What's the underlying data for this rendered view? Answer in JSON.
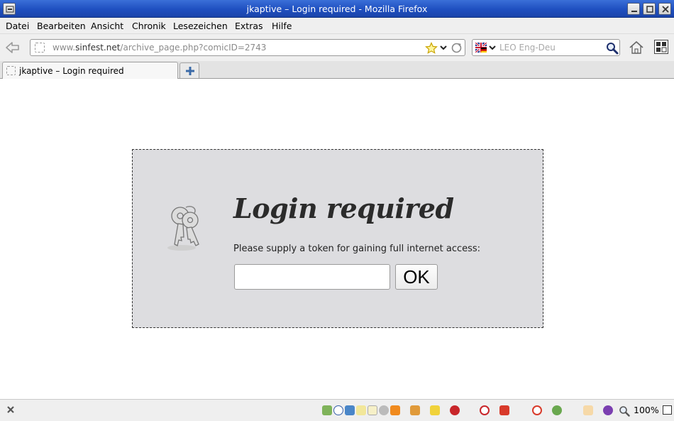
{
  "window": {
    "title": "jkaptive – Login required - Mozilla Firefox"
  },
  "menu": {
    "items": [
      {
        "label": "Datei"
      },
      {
        "label": "Bearbeiten"
      },
      {
        "label": "Ansicht"
      },
      {
        "label": "Chronik"
      },
      {
        "label": "Lesezeichen"
      },
      {
        "label": "Extras"
      },
      {
        "label": "Hilfe"
      }
    ]
  },
  "navbar": {
    "url_prefix": "www.",
    "url_domain": "sinfest.net",
    "url_path": "/archive_page.php?comicID=2743",
    "search_placeholder": "LEO Eng-Deu"
  },
  "tabs": [
    {
      "label": "jkaptive – Login required"
    }
  ],
  "page": {
    "heading": "Login required",
    "prompt": "Please supply a token for gaining full internet access:",
    "token_value": "",
    "ok_label": "OK"
  },
  "statusbar": {
    "zoom": "100%"
  },
  "colors": {
    "titlebar": "#2550c4",
    "login_box": "#dddde0",
    "chrome": "#efefef"
  }
}
